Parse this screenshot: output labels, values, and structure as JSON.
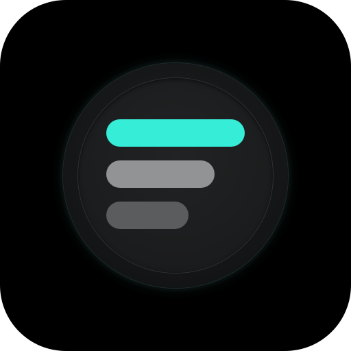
{
  "app_icon": {
    "icon_name": "filter-bars-icon",
    "colors": {
      "background": "#000000",
      "knob": "#1b1c1d",
      "bar_top": "#36edd8",
      "bar_middle": "#919394",
      "bar_bottom": "#5b5c5d"
    }
  }
}
